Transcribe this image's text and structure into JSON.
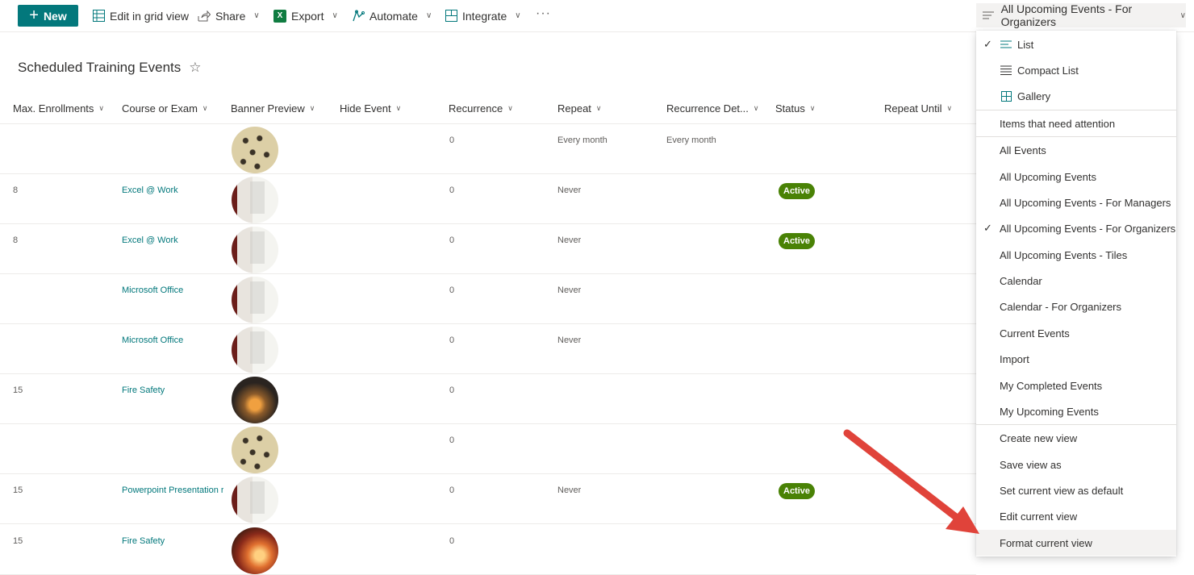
{
  "toolbar": {
    "new_label": "New",
    "grid_label": "Edit in grid view",
    "share_label": "Share",
    "export_label": "Export",
    "automate_label": "Automate",
    "integrate_label": "Integrate",
    "more_label": "···",
    "view_selector": "All Upcoming Events - For Organizers"
  },
  "page": {
    "title": "Scheduled Training Events"
  },
  "columns": [
    "Max. Enrollments",
    "Course or Exam",
    "Banner Preview",
    "Hide Event",
    "Recurrence",
    "Repeat",
    "Recurrence Det...",
    "Status",
    "Repeat Until"
  ],
  "rows": [
    {
      "max": "",
      "course": "",
      "banner": "chairs",
      "recurrence": "0",
      "repeat": "Every month",
      "details": "Every month",
      "status": ""
    },
    {
      "max": "8",
      "course": "Excel @ Work",
      "banner": "office",
      "recurrence": "0",
      "repeat": "Never",
      "details": "",
      "status": "Active"
    },
    {
      "max": "8",
      "course": "Excel @ Work",
      "banner": "office",
      "recurrence": "0",
      "repeat": "Never",
      "details": "",
      "status": "Active"
    },
    {
      "max": "",
      "course": "Microsoft Office",
      "banner": "office",
      "recurrence": "0",
      "repeat": "Never",
      "details": "",
      "status": ""
    },
    {
      "max": "",
      "course": "Microsoft Office",
      "banner": "office",
      "recurrence": "0",
      "repeat": "Never",
      "details": "",
      "status": ""
    },
    {
      "max": "15",
      "course": "Fire Safety",
      "banner": "fire1",
      "recurrence": "0",
      "repeat": "",
      "details": "",
      "status": ""
    },
    {
      "max": "",
      "course": "",
      "banner": "chairs",
      "recurrence": "0",
      "repeat": "",
      "details": "",
      "status": ""
    },
    {
      "max": "15",
      "course": "Powerpoint Presentation r",
      "banner": "office",
      "recurrence": "0",
      "repeat": "Never",
      "details": "",
      "status": "Active"
    },
    {
      "max": "15",
      "course": "Fire Safety",
      "banner": "fire2",
      "recurrence": "0",
      "repeat": "",
      "details": "",
      "status": ""
    }
  ],
  "menu": {
    "layouts": [
      "List",
      "Compact List",
      "Gallery"
    ],
    "attention": "Items that need attention",
    "views": [
      "All Events",
      "All Upcoming Events",
      "All Upcoming Events - For Managers",
      "All Upcoming Events - For Organizers",
      "All Upcoming Events - Tiles",
      "Calendar",
      "Calendar - For Organizers",
      "Current Events",
      "Import",
      "My Completed Events",
      "My Upcoming Events"
    ],
    "actions": [
      "Create new view",
      "Save view as",
      "Set current view as default",
      "Edit current view",
      "Format current view"
    ],
    "check": "✓"
  },
  "colors": {
    "accent": "#03787c",
    "active_badge": "#498205",
    "arrow": "#e0433a"
  }
}
